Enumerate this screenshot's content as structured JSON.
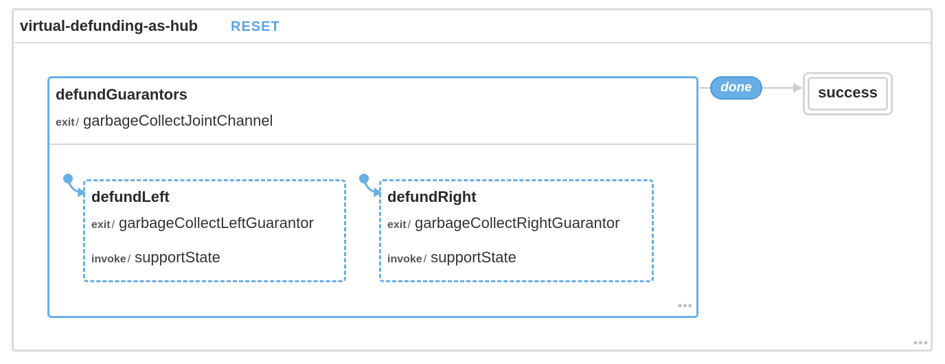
{
  "machine": {
    "title": "virtual-defunding-as-hub",
    "reset_label": "RESET"
  },
  "states": {
    "parent": {
      "name": "defundGuarantors",
      "exit_label": "exit",
      "exit_action": "garbageCollectJointChannel"
    },
    "left": {
      "name": "defundLeft",
      "exit_label": "exit",
      "exit_action": "garbageCollectLeftGuarantor",
      "invoke_label": "invoke",
      "invoke_action": "supportState"
    },
    "right": {
      "name": "defundRight",
      "exit_label": "exit",
      "exit_action": "garbageCollectRightGuarantor",
      "invoke_label": "invoke",
      "invoke_action": "supportState"
    },
    "final": {
      "name": "success"
    }
  },
  "transition": {
    "event": "done"
  },
  "slash": "/",
  "more_glyph": "•••",
  "colors": {
    "accent": "#6aaee6",
    "border": "#dcdcdc",
    "text": "#333333"
  }
}
